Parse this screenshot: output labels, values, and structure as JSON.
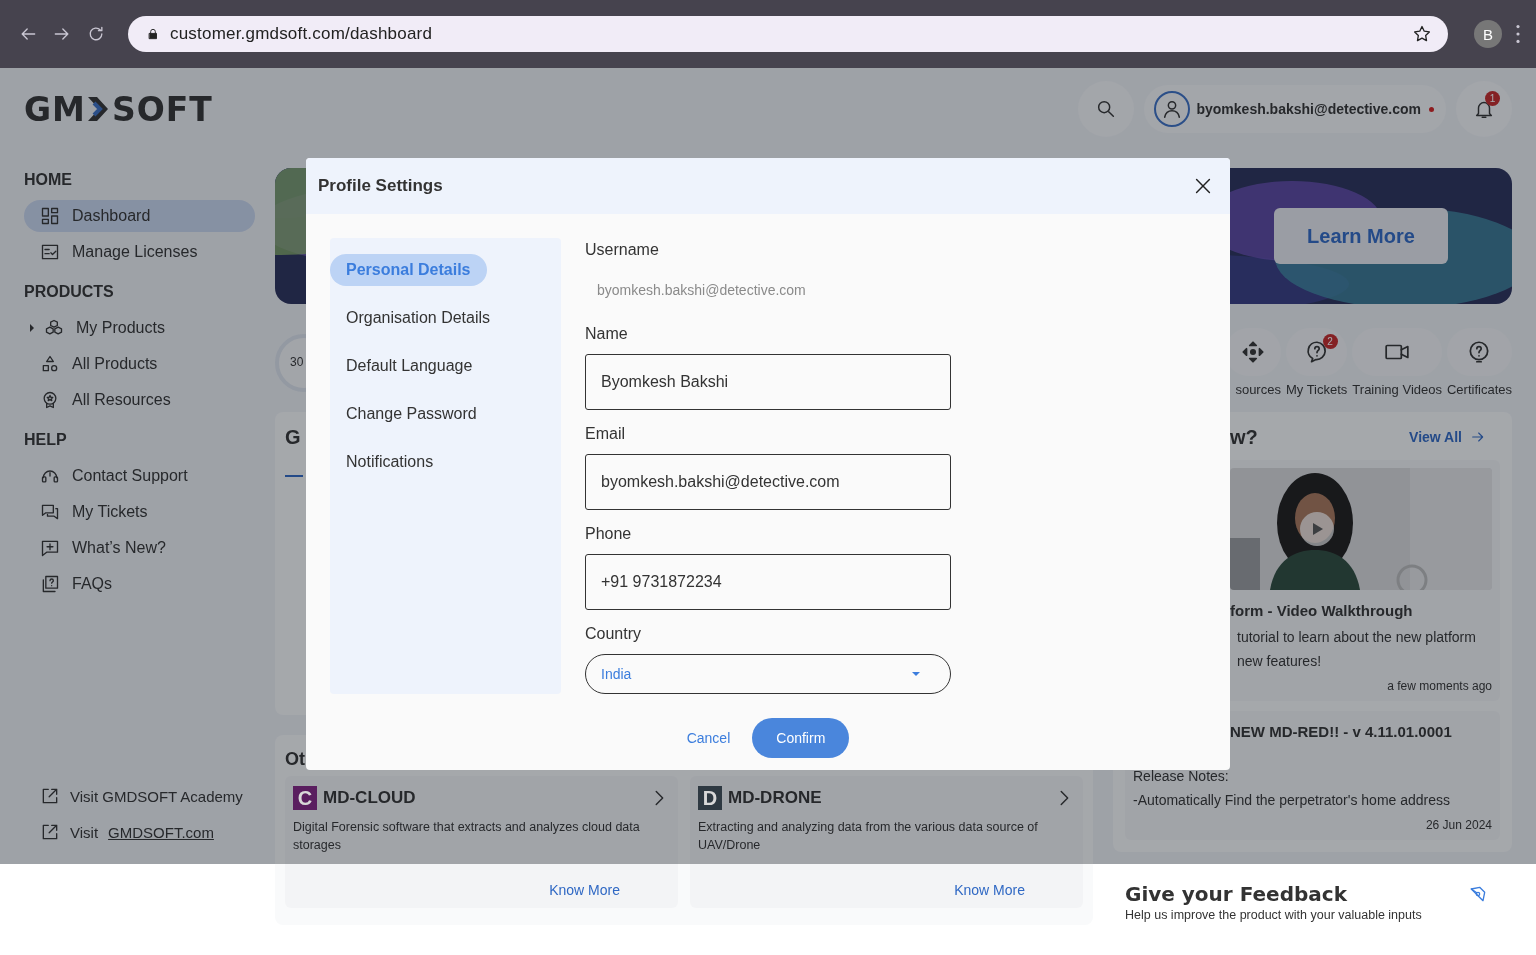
{
  "browser": {
    "url": "customer.gmdsoft.com/dashboard",
    "profile_initial": "B"
  },
  "header": {
    "logo_start": "GM",
    "logo_end": "SOFT",
    "user_email": "byomkesh.bakshi@detective.com",
    "notification_count": "1"
  },
  "sidebar": {
    "sections": [
      {
        "title": "HOME",
        "items": [
          {
            "label": "Dashboard",
            "selected": true
          },
          {
            "label": "Manage Licenses",
            "selected": false
          }
        ]
      },
      {
        "title": "PRODUCTS",
        "items": [
          {
            "label": "My Products",
            "selected": false,
            "expanded": false
          },
          {
            "label": "All Products",
            "selected": false
          },
          {
            "label": "All Resources",
            "selected": false
          }
        ]
      },
      {
        "title": "HELP",
        "items": [
          {
            "label": "Contact Support",
            "selected": false
          },
          {
            "label": "My Tickets",
            "selected": false
          },
          {
            "label": "What’s New?",
            "selected": false
          },
          {
            "label": "FAQs",
            "selected": false
          }
        ]
      }
    ],
    "links": [
      {
        "text": "Visit GMDSOFT Academy"
      },
      {
        "text": "Visit ",
        "link": "GMDSOFT.com"
      }
    ]
  },
  "banner": {
    "button": "Learn More"
  },
  "progress": {
    "reading": "30"
  },
  "quick_links": [
    {
      "label": "sources"
    },
    {
      "label": "My Tickets",
      "badge": "2"
    },
    {
      "label": "Training Videos"
    },
    {
      "label": "Certificates"
    }
  ],
  "getting_started": {
    "title": "G"
  },
  "whats_new": {
    "title": "w?",
    "view_all": "View All",
    "posts": [
      {
        "kind": "video",
        "title": "form -  Video Walkthrough",
        "lines": [
          "tutorial to learn about the new platform",
          "new features!"
        ],
        "time": "a few moments ago"
      },
      {
        "kind": "release",
        "title": "NEW MD-RED!! - v 4.11.01.0001",
        "lines": [
          "Release Notes:",
          "-Automatically Find the perpetrator's home address"
        ],
        "time": "26 Jun 2024"
      }
    ]
  },
  "other_products": {
    "title": "Ot",
    "products": [
      {
        "letter": "C",
        "name": "MD-CLOUD",
        "color": "#5a1e5f",
        "description": "Digital Forensic software that extracts and analyzes cloud data storages",
        "link": "Know More"
      },
      {
        "letter": "D",
        "name": "MD-DRONE",
        "color": "#2e3942",
        "description": "Extracting and analyzing data from the various data source of UAV/Drone",
        "link": "Know More"
      }
    ]
  },
  "feedback": {
    "title": "Give your Feedback",
    "subtitle": "Help us improve the product with your valuable inputs"
  },
  "modal": {
    "title": "Profile Settings",
    "tabs": [
      {
        "label": "Personal Details",
        "selected": true
      },
      {
        "label": "Organisation Details",
        "selected": false
      },
      {
        "label": "Default Language",
        "selected": false
      },
      {
        "label": "Change Password",
        "selected": false
      },
      {
        "label": "Notifications",
        "selected": false
      }
    ],
    "fields": [
      {
        "kind": "readonly",
        "label": "Username",
        "value": "byomkesh.bakshi@detective.com"
      },
      {
        "kind": "text",
        "label": "Name",
        "value": "Byomkesh Bakshi"
      },
      {
        "kind": "text",
        "label": "Email",
        "value": "byomkesh.bakshi@detective.com"
      },
      {
        "kind": "text",
        "label": "Phone",
        "value": "+91 9731872234"
      },
      {
        "kind": "select",
        "label": "Country",
        "value": "India"
      }
    ],
    "cancel": "Cancel",
    "confirm": "Confirm"
  }
}
